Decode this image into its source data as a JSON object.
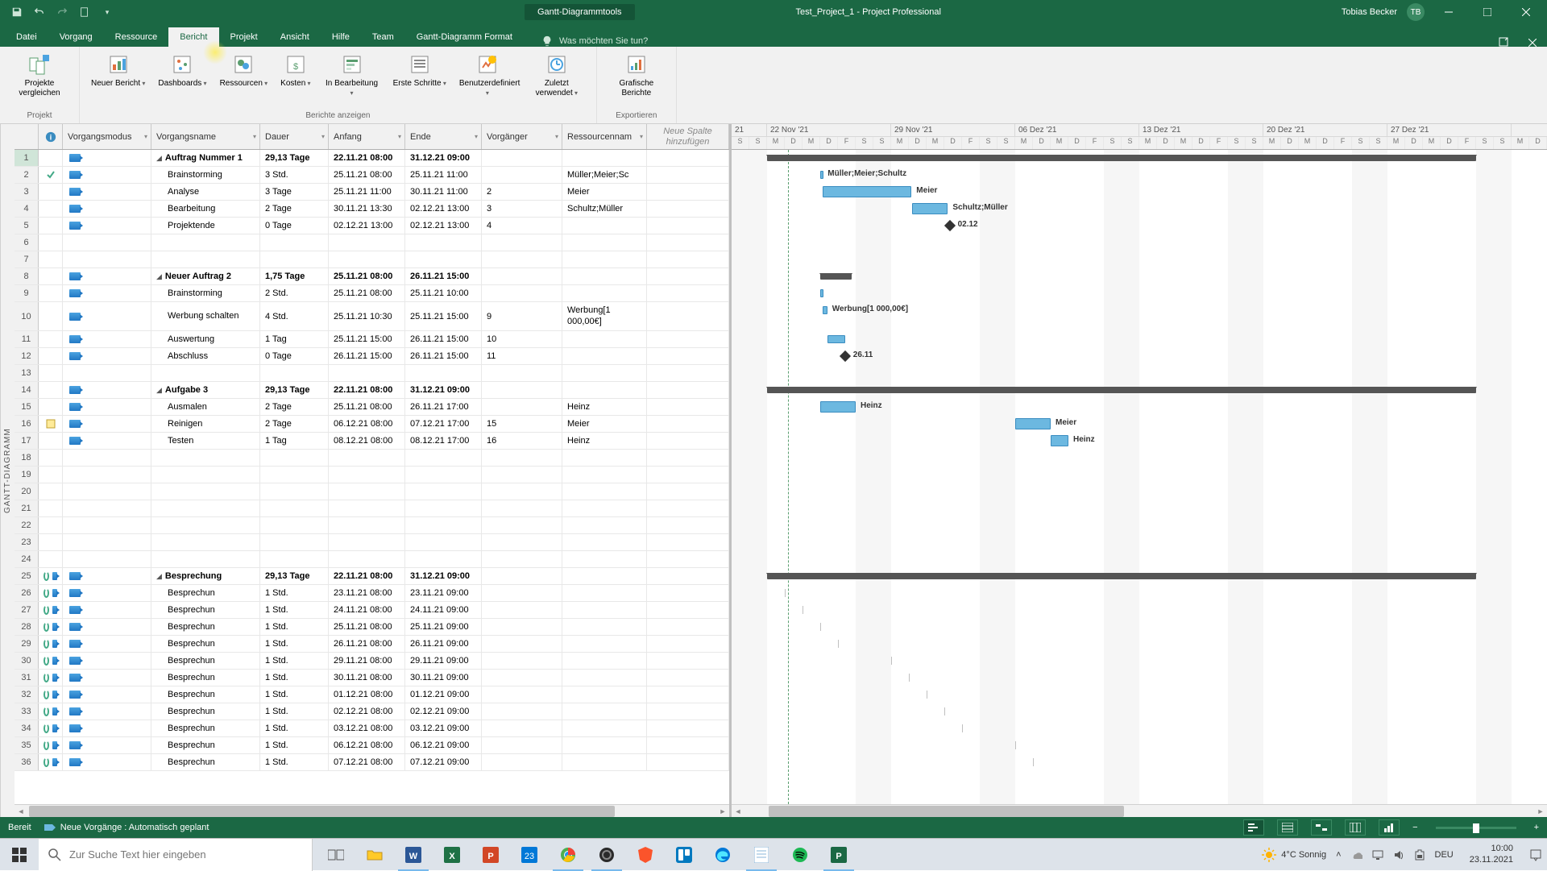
{
  "titlebar": {
    "tools_label": "Gantt-Diagrammtools",
    "doc_title": "Test_Project_1  -  Project Professional",
    "user_name": "Tobias Becker",
    "user_initials": "TB"
  },
  "tabs": {
    "items": [
      "Datei",
      "Vorgang",
      "Ressource",
      "Bericht",
      "Projekt",
      "Ansicht",
      "Hilfe",
      "Team",
      "Gantt-Diagramm Format"
    ],
    "active_index": 3,
    "tell_me_placeholder": "Was möchten Sie tun?"
  },
  "ribbon": {
    "groups": [
      {
        "label": "Projekt",
        "items": [
          {
            "text": "Projekte vergleichen"
          }
        ]
      },
      {
        "label": "Berichte anzeigen",
        "items": [
          {
            "text": "Neuer Bericht",
            "dd": true
          },
          {
            "text": "Dashboards",
            "dd": true
          },
          {
            "text": "Ressourcen",
            "dd": true
          },
          {
            "text": "Kosten",
            "dd": true
          },
          {
            "text": "In Bearbeitung",
            "dd": true
          },
          {
            "text": "Erste Schritte",
            "dd": true
          },
          {
            "text": "Benutzerdefiniert",
            "dd": true
          },
          {
            "text": "Zuletzt verwendet",
            "dd": true
          }
        ]
      },
      {
        "label": "Exportieren",
        "items": [
          {
            "text": "Grafische Berichte"
          }
        ]
      }
    ]
  },
  "side_label": "GANTT-DIAGRAMM",
  "columns": {
    "mode": "Vorgangsmodus",
    "name": "Vorgangsname",
    "dur": "Dauer",
    "start": "Anfang",
    "end": "Ende",
    "pred": "Vorgänger",
    "res": "Ressourcennam",
    "new": "Neue Spalte hinzufügen"
  },
  "rows": [
    {
      "n": 1,
      "info": "",
      "sel": true,
      "summary": true,
      "name": "Auftrag Nummer 1",
      "dur": "29,13 Tage",
      "start": "22.11.21 08:00",
      "end": "31.12.21 09:00",
      "pred": "",
      "res": ""
    },
    {
      "n": 2,
      "info": "check",
      "name": "Brainstorming",
      "dur": "3 Std.",
      "start": "25.11.21 08:00",
      "end": "25.11.21 11:00",
      "pred": "",
      "res": "Müller;Meier;Sc"
    },
    {
      "n": 3,
      "name": "Analyse",
      "dur": "3 Tage",
      "start": "25.11.21 11:00",
      "end": "30.11.21 11:00",
      "pred": "2",
      "res": "Meier"
    },
    {
      "n": 4,
      "name": "Bearbeitung",
      "dur": "2 Tage",
      "start": "30.11.21 13:30",
      "end": "02.12.21 13:00",
      "pred": "3",
      "res": "Schultz;Müller"
    },
    {
      "n": 5,
      "name": "Projektende",
      "dur": "0 Tage",
      "start": "02.12.21 13:00",
      "end": "02.12.21 13:00",
      "pred": "4",
      "res": ""
    },
    {
      "n": 6,
      "empty": true
    },
    {
      "n": 7,
      "empty": true
    },
    {
      "n": 8,
      "summary": true,
      "name": "Neuer Auftrag 2",
      "dur": "1,75 Tage",
      "start": "25.11.21 08:00",
      "end": "26.11.21 15:00",
      "pred": "",
      "res": ""
    },
    {
      "n": 9,
      "name": "Brainstorming",
      "dur": "2 Std.",
      "start": "25.11.21 08:00",
      "end": "25.11.21 10:00",
      "pred": "",
      "res": ""
    },
    {
      "n": 10,
      "tall": true,
      "name": "Werbung schalten",
      "dur": "4 Std.",
      "start": "25.11.21 10:30",
      "end": "25.11.21 15:00",
      "pred": "9",
      "res": "Werbung[1 000,00€]"
    },
    {
      "n": 11,
      "name": "Auswertung",
      "dur": "1 Tag",
      "start": "25.11.21 15:00",
      "end": "26.11.21 15:00",
      "pred": "10",
      "res": ""
    },
    {
      "n": 12,
      "name": "Abschluss",
      "dur": "0 Tage",
      "start": "26.11.21 15:00",
      "end": "26.11.21 15:00",
      "pred": "11",
      "res": ""
    },
    {
      "n": 13,
      "empty": true
    },
    {
      "n": 14,
      "summary": true,
      "name": "Aufgabe 3",
      "dur": "29,13 Tage",
      "start": "22.11.21 08:00",
      "end": "31.12.21 09:00",
      "pred": "",
      "res": ""
    },
    {
      "n": 15,
      "name": "Ausmalen",
      "dur": "2 Tage",
      "start": "25.11.21 08:00",
      "end": "26.11.21 17:00",
      "pred": "",
      "res": "Heinz"
    },
    {
      "n": 16,
      "info": "note",
      "name": "Reinigen",
      "dur": "2 Tage",
      "start": "06.12.21 08:00",
      "end": "07.12.21 17:00",
      "pred": "15",
      "res": "Meier"
    },
    {
      "n": 17,
      "name": "Testen",
      "dur": "1 Tag",
      "start": "08.12.21 08:00",
      "end": "08.12.21 17:00",
      "pred": "16",
      "res": "Heinz"
    },
    {
      "n": 18,
      "empty": true
    },
    {
      "n": 19,
      "empty": true
    },
    {
      "n": 20,
      "empty": true
    },
    {
      "n": 21,
      "empty": true
    },
    {
      "n": 22,
      "empty": true
    },
    {
      "n": 23,
      "empty": true
    },
    {
      "n": 24,
      "empty": true
    },
    {
      "n": 25,
      "info": "recur",
      "summary": true,
      "name": "Besprechung",
      "dur": "29,13 Tage",
      "start": "22.11.21 08:00",
      "end": "31.12.21 09:00",
      "pred": "",
      "res": ""
    },
    {
      "n": 26,
      "info": "recur",
      "name": "Besprechun",
      "dur": "1 Std.",
      "start": "23.11.21 08:00",
      "end": "23.11.21 09:00",
      "pred": "",
      "res": ""
    },
    {
      "n": 27,
      "info": "recur",
      "name": "Besprechun",
      "dur": "1 Std.",
      "start": "24.11.21 08:00",
      "end": "24.11.21 09:00",
      "pred": "",
      "res": ""
    },
    {
      "n": 28,
      "info": "recur",
      "name": "Besprechun",
      "dur": "1 Std.",
      "start": "25.11.21 08:00",
      "end": "25.11.21 09:00",
      "pred": "",
      "res": ""
    },
    {
      "n": 29,
      "info": "recur",
      "name": "Besprechun",
      "dur": "1 Std.",
      "start": "26.11.21 08:00",
      "end": "26.11.21 09:00",
      "pred": "",
      "res": ""
    },
    {
      "n": 30,
      "info": "recur",
      "name": "Besprechun",
      "dur": "1 Std.",
      "start": "29.11.21 08:00",
      "end": "29.11.21 09:00",
      "pred": "",
      "res": ""
    },
    {
      "n": 31,
      "info": "recur",
      "name": "Besprechun",
      "dur": "1 Std.",
      "start": "30.11.21 08:00",
      "end": "30.11.21 09:00",
      "pred": "",
      "res": ""
    },
    {
      "n": 32,
      "info": "recur",
      "name": "Besprechun",
      "dur": "1 Std.",
      "start": "01.12.21 08:00",
      "end": "01.12.21 09:00",
      "pred": "",
      "res": ""
    },
    {
      "n": 33,
      "info": "recur",
      "name": "Besprechun",
      "dur": "1 Std.",
      "start": "02.12.21 08:00",
      "end": "02.12.21 09:00",
      "pred": "",
      "res": ""
    },
    {
      "n": 34,
      "info": "recur",
      "name": "Besprechun",
      "dur": "1 Std.",
      "start": "03.12.21 08:00",
      "end": "03.12.21 09:00",
      "pred": "",
      "res": ""
    },
    {
      "n": 35,
      "info": "recur",
      "name": "Besprechun",
      "dur": "1 Std.",
      "start": "06.12.21 08:00",
      "end": "06.12.21 09:00",
      "pred": "",
      "res": ""
    },
    {
      "n": 36,
      "info": "recur",
      "name": "Besprechun",
      "dur": "1 Std.",
      "start": "07.12.21 08:00",
      "end": "07.12.21 09:00",
      "pred": "",
      "res": ""
    }
  ],
  "timeline": {
    "weeks": [
      "22 Nov '21",
      "29 Nov '21",
      "06 Dez '21",
      "13 Dez '21",
      "20 Dez '21",
      "27 Dez '21"
    ],
    "day_letters": [
      "M",
      "D",
      "M",
      "D",
      "F",
      "S",
      "S"
    ]
  },
  "gantt_labels": {
    "r2": "Müller;Meier;Schultz",
    "r3": "Meier",
    "r4": "Schultz;Müller",
    "r5": "02.12",
    "r10": "Werbung[1 000,00€]",
    "r12": "26.11",
    "r15": "Heinz",
    "r16": "Meier",
    "r17": "Heinz"
  },
  "statusbar": {
    "ready": "Bereit",
    "mode": "Neue Vorgänge : Automatisch geplant"
  },
  "taskbar": {
    "search_placeholder": "Zur Suche Text hier eingeben",
    "weather": "4°C  Sonnig",
    "lang": "DEU",
    "time": "10:00",
    "date": "23.11.2021"
  }
}
